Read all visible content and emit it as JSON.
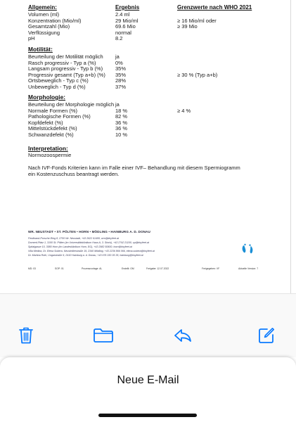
{
  "document": {
    "headers": {
      "col1": "Allgemein:",
      "col2": "Ergebnis",
      "col3": "Grenzwerte nach WHO 2021"
    },
    "allgemein": [
      {
        "label": "Volumen (ml)",
        "value": "2.4 ml",
        "ref": ""
      },
      {
        "label": "Konzentration (Mio/ml)",
        "value": "29 Mio/ml",
        "ref": "≥ 16 Mio/ml oder"
      },
      {
        "label": "Gesamtzahl (Mio)",
        "value": "69.6 Mio",
        "ref": "≥ 39 Mio"
      },
      {
        "label": "Verflüssigung",
        "value": "normal",
        "ref": ""
      },
      {
        "label": "pH",
        "value": "8.2",
        "ref": ""
      }
    ],
    "motilitaet_title": "Motilität:",
    "motilitaet": [
      {
        "label": "Beurteilung der Motilität möglich",
        "value": "ja",
        "ref": ""
      },
      {
        "label": "Rasch progressiv - Typ a (%)",
        "value": "0%",
        "ref": ""
      },
      {
        "label": "Langsam progressiv - Typ b (%)",
        "value": "35%",
        "ref": ""
      },
      {
        "label": "Progressiv gesamt (Typ a+b) (%)",
        "value": "35%",
        "ref": "≥ 30 % (Typ a+b)"
      },
      {
        "label": "Ortsbeweglich - Typ c (%)",
        "value": "28%",
        "ref": ""
      },
      {
        "label": "Unbeweglich - Typ d (%)",
        "value": "37%",
        "ref": ""
      }
    ],
    "morphologie_title": "Morphologie:",
    "morphologie": [
      {
        "label": "Beurteilung der Morphologie möglich",
        "value": "ja",
        "ref": ""
      },
      {
        "label": "Normale Formen (%)",
        "value": "18 %",
        "ref": "≥ 4 %"
      },
      {
        "label": "Pathologische Formen (%)",
        "value": "82 %",
        "ref": ""
      },
      {
        "label": "Kopfdefekt (%)",
        "value": "36 %",
        "ref": ""
      },
      {
        "label": "Mittelstückdefekt (%)",
        "value": "36 %",
        "ref": ""
      },
      {
        "label": "Schwanzdefekt (%)",
        "value": "10 %",
        "ref": ""
      }
    ],
    "interpretation_title": "Interpretation:",
    "interpretation_text": "Normozoospermie",
    "note_line1": "Nach IVF-Fonds Kriterien kann im Falle einer IVF– Behandlung mit diesem Spermiogramm",
    "note_line2": "ein Kostenzuschuss beantragt werden.",
    "footer": {
      "title": "WR. NEUSTADT • ST. PÖLTEN • HORN • MÖDLING • HAINBURG A. D. DONAU",
      "lines": [
        "Ferdinand-Porsche-Ring 8, 2700 Wr. Neustadt, +43 2622 61455, wrn@tinyfeet.at",
        "Domerd-Platz 1, 3100 St. Pölten (im Universitätsklinikum Haus A, 3. Stock), +43 2742 21100, sp@tinyfeet.at",
        "Spitalgasse 10, 3580 Horn (im Landesklinikum Horn, EG), +43 2982 50600, horn@tinyfeet.at",
        "Villa Medica, Dr. Elena Sobera, Neusiedlerstraße 19, 2340 Mödling, +43 2236 866 066, elena.sobera@tinyfeet.at",
        "Dr. Martina Roth, Ungarstraße 9, 2410 Hainburg a. d. Donau, +43 676 330 35 35, hainburg@tinyfeet.at"
      ],
      "meta": {
        "md": "MD: 03",
        "sop": "SOP: 01",
        "protocol": "Prozessvorlage: AL",
        "created": "Erstellt: GM",
        "release": "Freigabe: 12.07.2022",
        "approved": "Freigegeben: VF",
        "version": "Aktuelle Version: 7"
      }
    }
  },
  "toolbar": {
    "icons": [
      "trash-icon",
      "folder-icon",
      "reply-icon",
      "compose-icon"
    ],
    "accent": "#0a7aff"
  },
  "sheet": {
    "title": "Neue E-Mail"
  }
}
